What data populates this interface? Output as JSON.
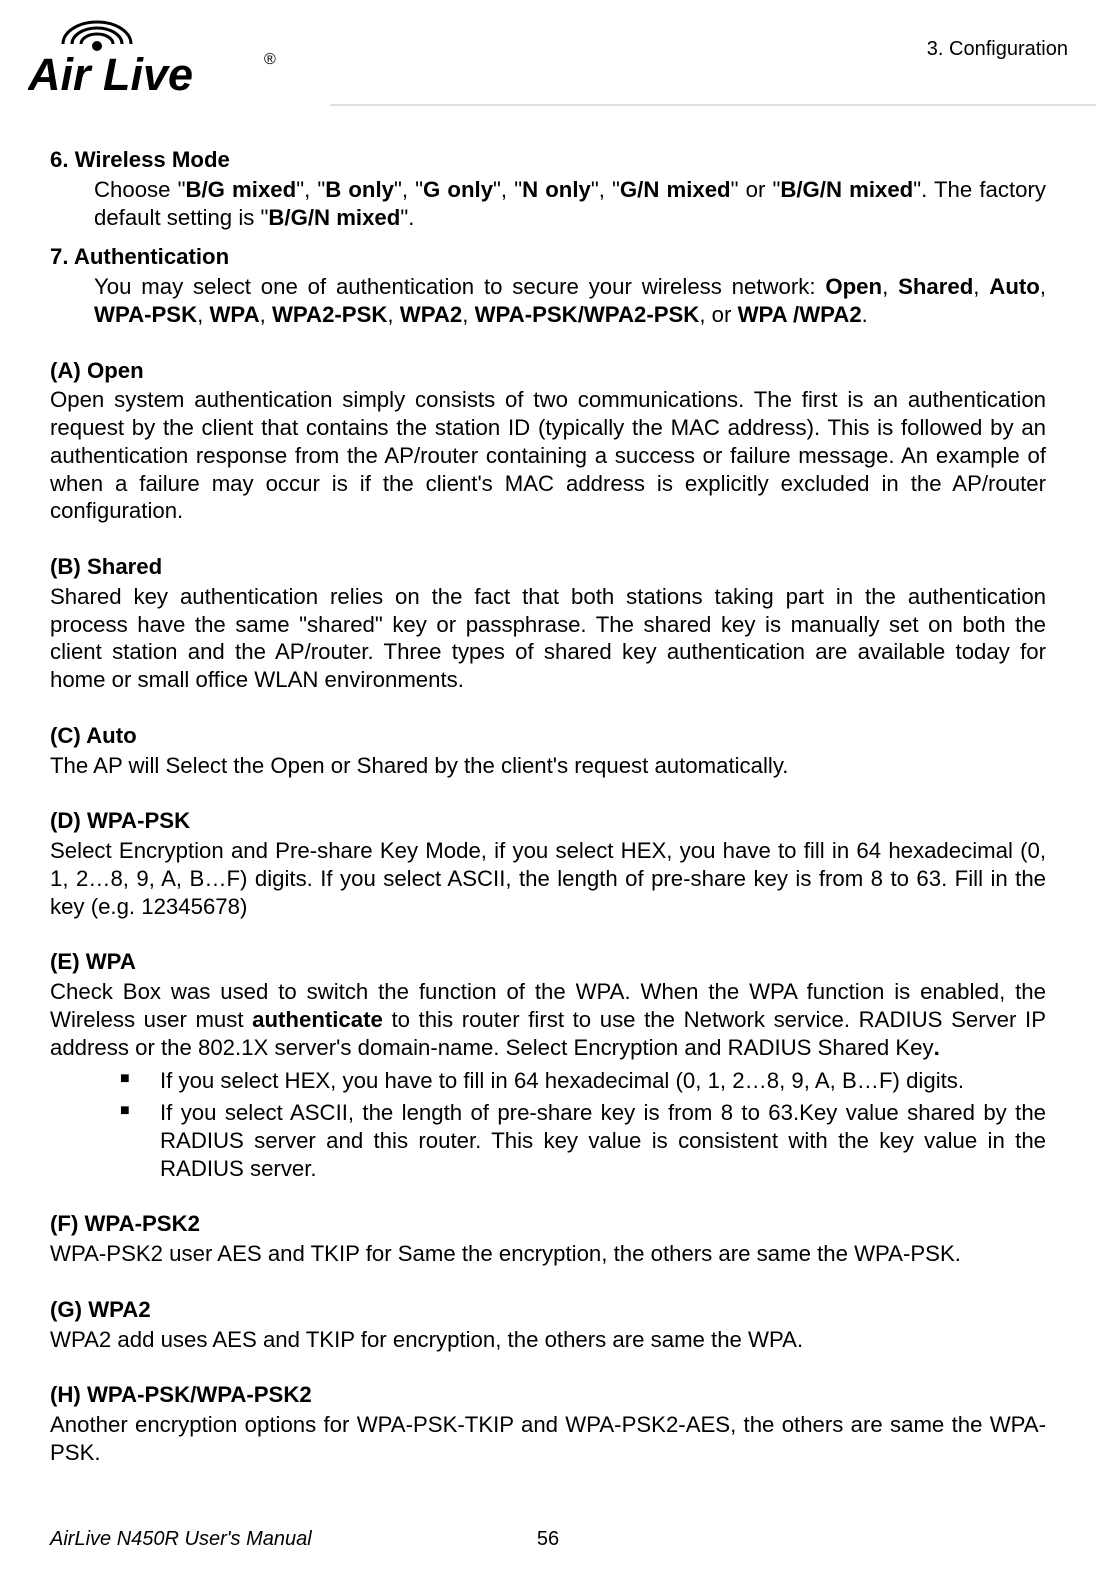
{
  "header": {
    "breadcrumb": "3. Configuration",
    "logo_alt": "Air Live"
  },
  "items": {
    "n6": {
      "num": "6.",
      "title": "Wireless Mode",
      "body_html": "Choose \"<b>B/G mixed</b>\", \"<b>B only</b>\", \"<b>G only</b>\", \"<b>N only</b>\", \"<b>G/N mixed</b>\" or \"<b>B/G/N mixed</b>\". The factory default setting is \"<b>B/G/N mixed</b>\"."
    },
    "n7": {
      "num": "7.",
      "title": "Authentication",
      "body_html": "You may select one of authentication to secure your wireless network: <b>Open</b>, <b>Shared</b>, <b>Auto</b>, <b>WPA-PSK</b>, <b>WPA</b>, <b>WPA2-PSK</b>, <b>WPA2</b>, <b>WPA-PSK/WPA2-PSK</b>, or <b>WPA /WPA2</b>."
    }
  },
  "sections": {
    "A": {
      "head": "(A)   Open",
      "body": "Open system authentication simply consists of two communications. The first is an authentication request by the client that contains the station ID (typically the MAC address). This is followed by an authentication response from the AP/router containing a success or failure message. An example of when a failure may occur is if the client's MAC address is explicitly excluded in the AP/router configuration."
    },
    "B": {
      "head": "(B)   Shared",
      "body": "Shared key authentication relies on the fact that both stations taking part in the authentication process have the same \"shared\" key or passphrase. The shared key is manually set on both the client station and the AP/router. Three types of shared key authentication are available today for home or small office WLAN environments."
    },
    "C": {
      "head": "(C)   Auto",
      "body": "The AP will Select the Open or Shared by the client's request automatically."
    },
    "D": {
      "head": "(D)   WPA-PSK",
      "body": "Select Encryption and Pre-share Key Mode, if you select HEX, you have to fill in 64 hexadecimal (0, 1, 2…8, 9, A, B…F) digits. If you select ASCII, the length of pre-share key is from 8 to 63. Fill in the key (e.g. 12345678)"
    },
    "E": {
      "head": "(E)   WPA",
      "body_html": "Check Box was used to switch the function of the WPA. When the WPA function is enabled, the Wireless user must <b>authenticate</b> to this router first to use the Network service. RADIUS Server IP address or the 802.1X server's domain-name. Select Encryption and RADIUS Shared Key<b>.</b>",
      "bullets": [
        "If you select HEX, you have to fill in 64 hexadecimal (0, 1, 2…8, 9, A, B…F) digits.",
        "If you select ASCII, the length of pre-share key is from 8 to 63.Key value shared by the RADIUS server and this router. This key value is consistent with the key value in the RADIUS server."
      ]
    },
    "F": {
      "head": "(F)   WPA-PSK2",
      "body": "WPA-PSK2 user AES and TKIP for Same the encryption, the others are same the WPA-PSK."
    },
    "G": {
      "head": "(G)   WPA2",
      "body": "WPA2 add uses AES and TKIP for encryption, the others are same the WPA."
    },
    "H": {
      "head": "(H)   WPA-PSK/WPA-PSK2",
      "body": "Another encryption options for WPA-PSK-TKIP and WPA-PSK2-AES, the others are same the WPA-PSK."
    }
  },
  "footer": {
    "manual": "AirLive N450R User's Manual",
    "page": "56"
  }
}
